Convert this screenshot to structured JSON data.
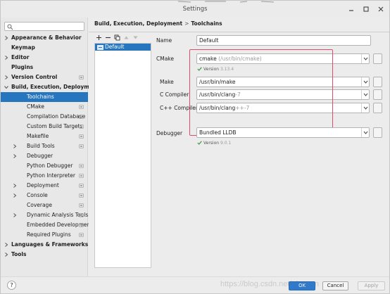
{
  "window": {
    "title": "Settings",
    "controls": {
      "minimize_icon": "minimize-icon",
      "maximize_icon": "maximize-icon",
      "close_icon": "close-icon"
    }
  },
  "search": {
    "placeholder": "",
    "icon": "search-icon"
  },
  "tree": [
    {
      "label": "Appearance & Behavior",
      "bold": true,
      "arrow": "right",
      "cfg": false
    },
    {
      "label": "Keymap",
      "bold": true,
      "arrow": "none",
      "cfg": false
    },
    {
      "label": "Editor",
      "bold": true,
      "arrow": "right",
      "cfg": false
    },
    {
      "label": "Plugins",
      "bold": true,
      "arrow": "none",
      "cfg": false
    },
    {
      "label": "Version Control",
      "bold": true,
      "arrow": "right",
      "cfg": true
    },
    {
      "label": "Build, Execution, Deployment",
      "bold": true,
      "arrow": "down",
      "cfg": false
    },
    {
      "label": "Toolchains",
      "bold": false,
      "arrow": "none",
      "cfg": false,
      "selected": true
    },
    {
      "label": "CMake",
      "bold": false,
      "arrow": "none",
      "cfg": true
    },
    {
      "label": "Compilation Database",
      "bold": false,
      "arrow": "none",
      "cfg": true
    },
    {
      "label": "Custom Build Targets",
      "bold": false,
      "arrow": "none",
      "cfg": true
    },
    {
      "label": "Makefile",
      "bold": false,
      "arrow": "none",
      "cfg": true
    },
    {
      "label": "Build Tools",
      "bold": false,
      "arrow": "right",
      "cfg": true
    },
    {
      "label": "Debugger",
      "bold": false,
      "arrow": "right",
      "cfg": false
    },
    {
      "label": "Python Debugger",
      "bold": false,
      "arrow": "none",
      "cfg": true
    },
    {
      "label": "Python Interpreter",
      "bold": false,
      "arrow": "none",
      "cfg": true
    },
    {
      "label": "Deployment",
      "bold": false,
      "arrow": "right",
      "cfg": true
    },
    {
      "label": "Console",
      "bold": false,
      "arrow": "right",
      "cfg": true
    },
    {
      "label": "Coverage",
      "bold": false,
      "arrow": "none",
      "cfg": true
    },
    {
      "label": "Dynamic Analysis Tools",
      "bold": false,
      "arrow": "right",
      "cfg": true
    },
    {
      "label": "Embedded Development",
      "bold": false,
      "arrow": "none",
      "cfg": true
    },
    {
      "label": "Required Plugins",
      "bold": false,
      "arrow": "none",
      "cfg": true
    },
    {
      "label": "Languages & Frameworks",
      "bold": true,
      "arrow": "right",
      "cfg": false
    },
    {
      "label": "Tools",
      "bold": true,
      "arrow": "right",
      "cfg": false
    }
  ],
  "breadcrumb": {
    "parent": "Build, Execution, Deployment",
    "separator": ">",
    "current": "Toolchains"
  },
  "toolbar": {
    "add_icon": "add-icon",
    "remove_icon": "remove-icon",
    "copy_icon": "copy-icon",
    "up_icon": "arrow-up-icon",
    "down_icon": "arrow-down-icon"
  },
  "toolchains": [
    {
      "label": "Default",
      "icon": "toolchain-icon"
    }
  ],
  "form": {
    "name_label": "Name",
    "name_value": "Default",
    "cmake_label": "CMake",
    "cmake_value": "cmake",
    "cmake_hint": "/usr/bin/cmake",
    "cmake_version_label": "Version",
    "cmake_version": "3.13.4",
    "make_label": "Make",
    "make_value": "/usr/bin/make",
    "c_compiler_label": "C Compiler",
    "c_compiler_value": "/usr/bin/clang",
    "c_compiler_suffix": "-7",
    "cxx_compiler_label": "C++ Compiler",
    "cxx_compiler_value": "/usr/bin/clang",
    "cxx_compiler_suffix": "++-7",
    "debugger_label": "Debugger",
    "debugger_value": "Bundled LLDB",
    "debugger_version_label": "Version",
    "debugger_version": "9.0.1",
    "browse_label": "..."
  },
  "buttons": {
    "help": "?",
    "ok": "OK",
    "cancel": "Cancel",
    "apply": "Apply"
  },
  "watermark": "https://blog.csdn.net/qingyun",
  "colors": {
    "selection": "#2675bf",
    "annotation_box": "#e34a6a",
    "ok_button": "#2d7bd0"
  }
}
